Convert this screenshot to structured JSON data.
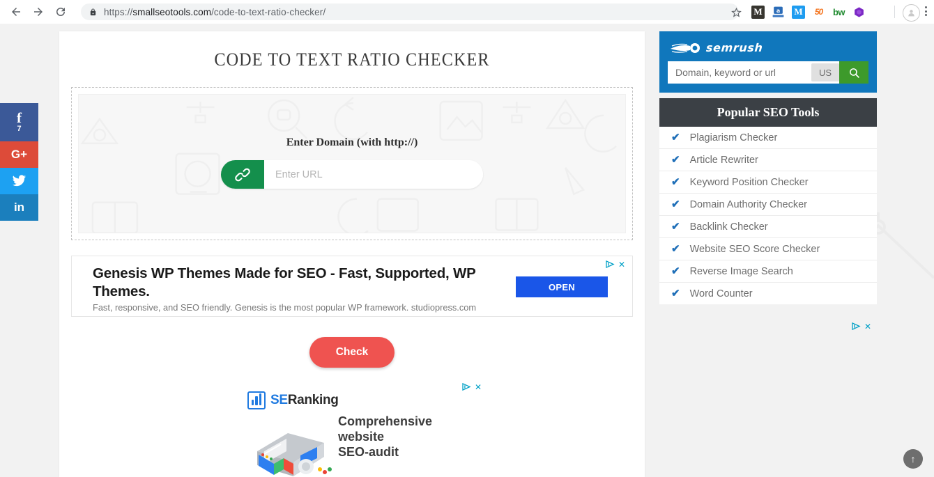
{
  "browser": {
    "back_icon": "back-arrow-icon",
    "forward_icon": "forward-arrow-icon",
    "reload_icon": "reload-icon",
    "lock_icon": "lock-icon",
    "url_scheme": "https://",
    "url_domain": "smallseotools.com",
    "url_path": "/code-to-text-ratio-checker/",
    "star_icon": "bookmark-star-icon",
    "extensions": [
      {
        "name": "notion-extension-icon",
        "label": "M"
      },
      {
        "name": "amazon-assistant-extension-icon",
        "label": "a"
      },
      {
        "name": "mailtrack-extension-icon",
        "label": "M"
      },
      {
        "name": "seoquake-extension-icon",
        "label": "50"
      },
      {
        "name": "buzzsumo-extension-icon",
        "label": "bw"
      },
      {
        "name": "purple-hexagon-extension-icon",
        "label": ""
      }
    ],
    "profile_icon": "profile-avatar-icon",
    "menu_icon": "three-dot-menu-icon"
  },
  "social": [
    {
      "name": "facebook-share-button",
      "glyph": "f",
      "count": "7",
      "color": "#3b5998"
    },
    {
      "name": "google-plus-share-button",
      "glyph": "G+",
      "count": "",
      "color": "#dd4b39"
    },
    {
      "name": "twitter-share-button",
      "glyph": "",
      "count": "",
      "color": "#1da1f2"
    },
    {
      "name": "linkedin-share-button",
      "glyph": "in",
      "count": "",
      "color": "#1b7fbd"
    }
  ],
  "tool": {
    "title": "CODE TO TEXT RATIO CHECKER",
    "dropzone_label": "Enter Domain (with http://)",
    "url_placeholder": "Enter URL",
    "url_value": "",
    "link_icon": "chain-link-icon",
    "check_label": "Check",
    "check_color": "#ef5350"
  },
  "ad_banner": {
    "title": "Genesis WP Themes Made for SEO - Fast, Supported, WP Themes.",
    "description": "Fast, responsive, and SEO friendly. Genesis is the most popular WP framework. studiopress.com",
    "cta_label": "OPEN",
    "cta_color": "#1a56e8",
    "adchoices_icon": "adchoices-icon",
    "close_icon": "close-ad-icon"
  },
  "ad_seranking": {
    "brand_se": "SE",
    "brand_ranking": "Ranking",
    "headline_line1": "Comprehensive",
    "headline_line2": "website",
    "headline_line3": "SEO-audit",
    "adchoices_icon": "adchoices-icon",
    "close_icon": "close-ad-icon"
  },
  "sidebar": {
    "semrush": {
      "brand": "semrush",
      "logo_icon": "semrush-comet-logo-icon",
      "search_placeholder": "Domain, keyword or url",
      "search_value": "",
      "country": "US",
      "search_icon": "search-magnifier-icon",
      "bg_color": "#1077bc",
      "button_color": "#3d9a2b"
    },
    "tools_header": "Popular SEO Tools",
    "tools_header_color": "#3b4045",
    "check_color": "#1f6fb8",
    "tools": [
      {
        "label": "Plagiarism Checker",
        "icon": "check-icon"
      },
      {
        "label": "Article Rewriter",
        "icon": "check-icon"
      },
      {
        "label": "Keyword Position Checker",
        "icon": "check-icon"
      },
      {
        "label": "Domain Authority Checker",
        "icon": "check-icon"
      },
      {
        "label": "Backlink Checker",
        "icon": "check-icon"
      },
      {
        "label": "Website SEO Score Checker",
        "icon": "check-icon"
      },
      {
        "label": "Reverse Image Search",
        "icon": "check-icon"
      },
      {
        "label": "Word Counter",
        "icon": "check-icon"
      }
    ],
    "adchoices_icon": "adchoices-icon",
    "close_icon": "close-ad-icon"
  },
  "scroll_top": {
    "icon": "arrow-up-icon",
    "label": "↑"
  }
}
